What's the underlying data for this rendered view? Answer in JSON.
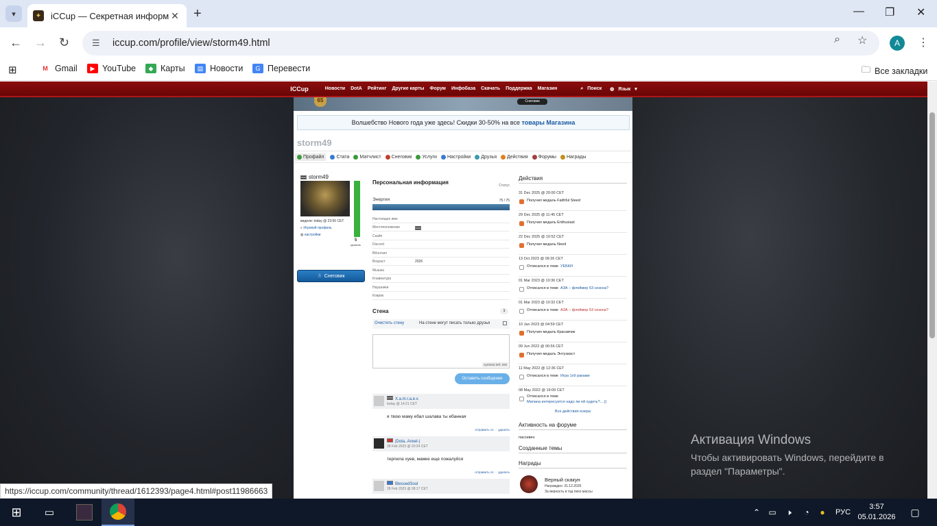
{
  "browser": {
    "tab_title": "iCCup — Секретная информац",
    "url": "iccup.com/profile/view/storm49.html",
    "bookmarks": [
      "Gmail",
      "YouTube",
      "Карты",
      "Новости",
      "Перевести"
    ],
    "all_bookmarks": "Все закладки",
    "status_link": "https://iccup.com/community/thread/1612393/page4.html#post11986663"
  },
  "site": {
    "logo": "ICCup",
    "nav": [
      "Новости",
      "DotA",
      "Рейтинг",
      "Другие карты",
      "Форум",
      "Инфобаза",
      "Скачать",
      "Поддержка",
      "Магазин"
    ],
    "search": "Поиск",
    "lang": "Язык",
    "banner_level": "65",
    "banner_badge": "Снеговик",
    "promo_text": "Волшебство Нового года уже здесь! Скидки 30-50% на все",
    "promo_link": "товары Магазина"
  },
  "profile": {
    "username": "storm49",
    "tabs": [
      "Профайл",
      "Стата",
      "Матчлист",
      "Снеговик",
      "Услуги",
      "Настройки",
      "Друзья",
      "Действия",
      "Форумы",
      "Награды"
    ],
    "name_small": "storm49",
    "visited": "видели: today @ 23:56 CET",
    "game_profile": "Игровой профиль",
    "settings": "настройки",
    "energy_level": "5",
    "energy_label": "уровень",
    "snowman_button": "Снеговик"
  },
  "personal": {
    "title": "Персональная информация",
    "status": "Статус",
    "energy_title": "Энергия",
    "energy_value": "75 / 75",
    "fields": [
      {
        "label": "Настоящее имя",
        "value": ""
      },
      {
        "label": "Местоположение",
        "value": ""
      },
      {
        "label": "Скайп",
        "value": ""
      },
      {
        "label": "Discord",
        "value": ""
      },
      {
        "label": "ВКонтакт",
        "value": ""
      },
      {
        "label": "Возраст",
        "value": "2026"
      },
      {
        "label": "Мышка",
        "value": ""
      },
      {
        "label": "Клавиатура",
        "value": ""
      },
      {
        "label": "Наушники",
        "value": ""
      },
      {
        "label": "Коврик",
        "value": ""
      }
    ]
  },
  "wall": {
    "title": "Стена",
    "count": "1",
    "clear": "Очистить стену",
    "friends_only": "На стене могут писать только друзья",
    "symbols_left": "symbols left: 200",
    "send": "Оставить сообщение",
    "send_pm": "отправить лс",
    "delete": "удалить",
    "posts": [
      {
        "author": "X.a.m.r.a.e.v.",
        "date": "today @ 14:21 CET",
        "text": "я твою маму ебал шалава ты ебанная"
      },
      {
        "author": "|Dota..Anxel-|",
        "date": "28 Feb 2023 @ 20:24 CET",
        "text": "терпила хуев, мамке еще пожалуйся"
      },
      {
        "author": "BlessedSoul",
        "date": "28 Feb 2023 @ 08:17 CET",
        "text": ""
      }
    ]
  },
  "actions": {
    "title": "Действия",
    "items": [
      {
        "date": "31 Dec 2025 @ 20:00 CET",
        "text": "Получил медаль Faithful Steed",
        "link": ""
      },
      {
        "date": "29 Dec 2025 @ 11:45 CET",
        "text": "Получил медаль Enthusiast",
        "link": ""
      },
      {
        "date": "22 Dec 2025 @ 10:52 CET",
        "text": "Получил медаль Need",
        "link": ""
      },
      {
        "date": "13 Oct 2023 @ 09:26 CET",
        "text": "Отписался в теме",
        "link": "УЕБКИ"
      },
      {
        "date": "01 Mar 2023 @ 10:36 CET",
        "text": "Отписался в теме",
        "link": "АЗА – флеймер 53 сезона?"
      },
      {
        "date": "01 Mar 2023 @ 10:32 CET",
        "text": "Отписался в теме",
        "link": "АЗА – флеймер 53 сезона?"
      },
      {
        "date": "10 Jan 2023 @ 04:59 CET",
        "text": "Получил медаль Красавчик",
        "link": ""
      },
      {
        "date": "09 Jun 2022 @ 06:56 CET",
        "text": "Получил медаль Энтузиаст",
        "link": ""
      },
      {
        "date": "11 May 2022 @ 12:36 CET",
        "text": "Отписался в теме",
        "link": "Игра 1x9 раками"
      },
      {
        "date": "08 May 2022 @ 19:09 CET",
        "text": "Отписался в теме",
        "link": "Милана интересуется надо ли ей худеть?....))"
      }
    ],
    "all": "Все действия юзера"
  },
  "forum": {
    "title": "Активность на форуме",
    "value": "пассивен",
    "topics_title": "Созданные темы",
    "awards_title": "Награды",
    "award_name": "Верный скакун",
    "award_date": "Награжден: 31.12.2025",
    "award_sub": "За верность и год лихо массы"
  },
  "windows": {
    "activation_title": "Активация Windows",
    "activation_text": "Чтобы активировать Windows, перейдите в раздел \"Параметры\".",
    "lang": "РУС",
    "time": "3:57",
    "date": "05.01.2026"
  }
}
